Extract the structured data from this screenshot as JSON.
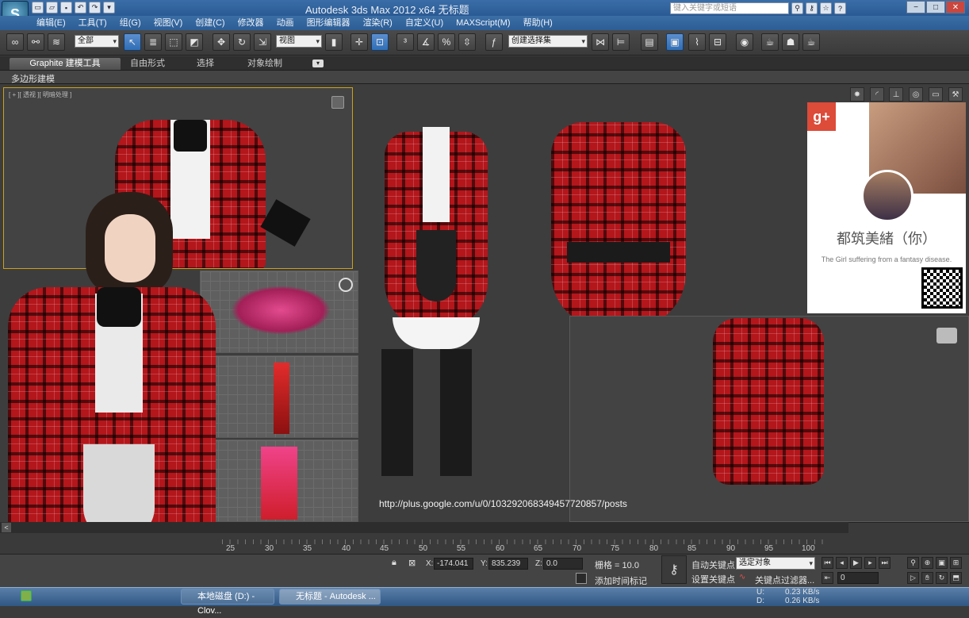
{
  "window": {
    "title": "Autodesk 3ds Max  2012 x64    无标题",
    "search_placeholder": "键入关键字或短语",
    "min": "−",
    "max": "□",
    "close": "✕"
  },
  "menu": [
    "编辑(E)",
    "工具(T)",
    "组(G)",
    "视图(V)",
    "创建(C)",
    "修改器",
    "动画",
    "图形编辑器",
    "渲染(R)",
    "自定义(U)",
    "MAXScript(M)",
    "帮助(H)"
  ],
  "toolbar": {
    "filter_dropdown": "全部",
    "refcoord_dropdown": "视图",
    "selection_set_dropdown": "创建选择集"
  },
  "ribbon": {
    "tabs": [
      "Graphite 建模工具",
      "自由形式",
      "选择",
      "对象绘制"
    ],
    "sub": "多边形建模"
  },
  "timeline": {
    "ticks": [
      "25",
      "30",
      "35",
      "40",
      "45",
      "50",
      "55",
      "60",
      "65",
      "70",
      "75",
      "80",
      "85",
      "90",
      "95",
      "100"
    ],
    "left_arrow": "<"
  },
  "status": {
    "x_label": "X:",
    "x_value": "-174.041",
    "y_label": "Y:",
    "y_value": "835.239",
    "z_label": "Z:",
    "z_value": "0.0",
    "grid": "栅格 = 10.0",
    "add_time_tag": "添加时间标记",
    "auto_key": "自动关键点",
    "set_key": "设置关键点",
    "key_filters": "关键点过滤器...",
    "selected_dropdown": "选定对象",
    "frame_value": "0",
    "u_label": "U:",
    "u_value": "0.23 KB/s",
    "d_label": "D:",
    "d_value": "0.26 KB/s"
  },
  "viewports": {
    "top_left_label": "[ + ][ 透视 ][ 明暗处理 ]"
  },
  "taskbar": {
    "items": [
      "本地磁盘 (D:) - Clov...",
      "无标题 - Autodesk ..."
    ]
  },
  "gplus_card": {
    "badge": "g+",
    "name": "都筑美緒（你）",
    "tagline": "The Girl suffering from a fantasy disease."
  },
  "watermark_url": "http://plus.google.com/u/0/103292068349457720857/posts",
  "colors": {
    "accent": "#caa21c",
    "plaid": "#b3161b",
    "gplus": "#dd4b39"
  }
}
